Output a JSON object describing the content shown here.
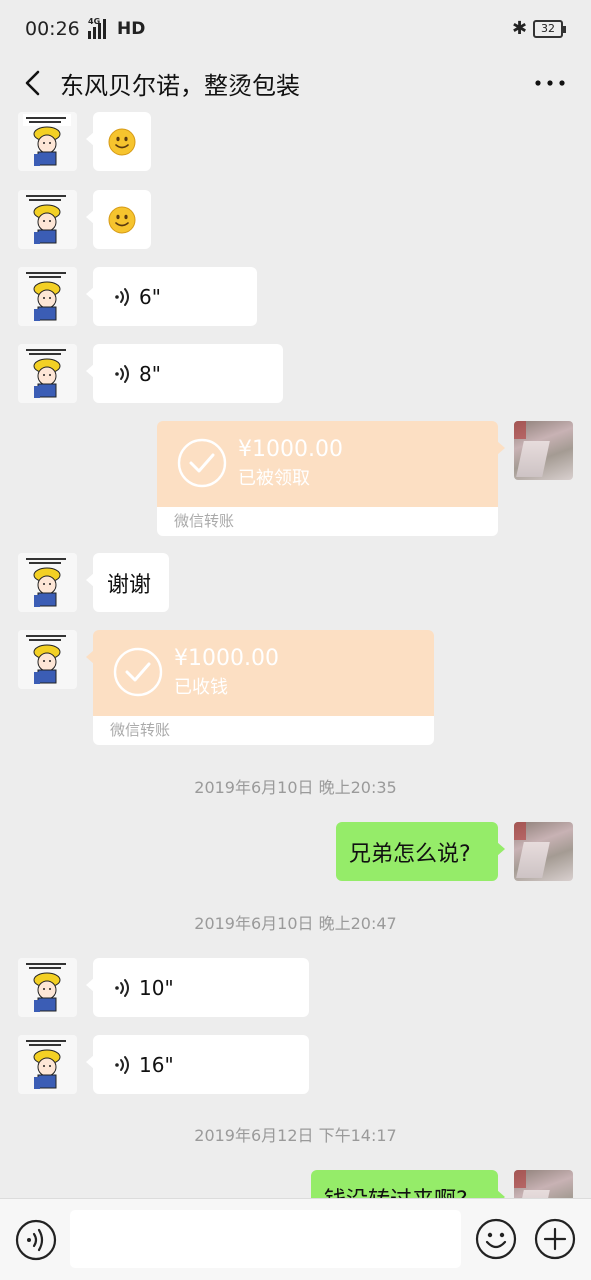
{
  "status_bar": {
    "time": "00:26",
    "network": "4G",
    "hd": "HD",
    "battery": "32"
  },
  "header": {
    "title": "东风贝尔诺，整烫包装"
  },
  "cartoon_avatar_text": "老板，我随时等候您的订单。",
  "messages": {
    "voice_1": "6\"",
    "voice_2": "8\"",
    "transfer_1": {
      "amount": "¥1000.00",
      "status": "已被领取",
      "label": "微信转账"
    },
    "text_thanks": "谢谢",
    "transfer_2": {
      "amount": "¥1000.00",
      "status": "已收钱",
      "label": "微信转账"
    },
    "ts_1": "2019年6月10日 晚上20:35",
    "text_brother": "兄弟怎么说?",
    "ts_2": "2019年6月10日 晚上20:47",
    "voice_3": "10\"",
    "voice_4": "16\"",
    "ts_3": "2019年6月12日 下午14:17",
    "text_partial": "钱没转过来啊?"
  },
  "input": {
    "placeholder": ""
  },
  "colors": {
    "background": "#ededed",
    "self_bubble": "#95ec69",
    "transfer": "#fcdfc3"
  }
}
